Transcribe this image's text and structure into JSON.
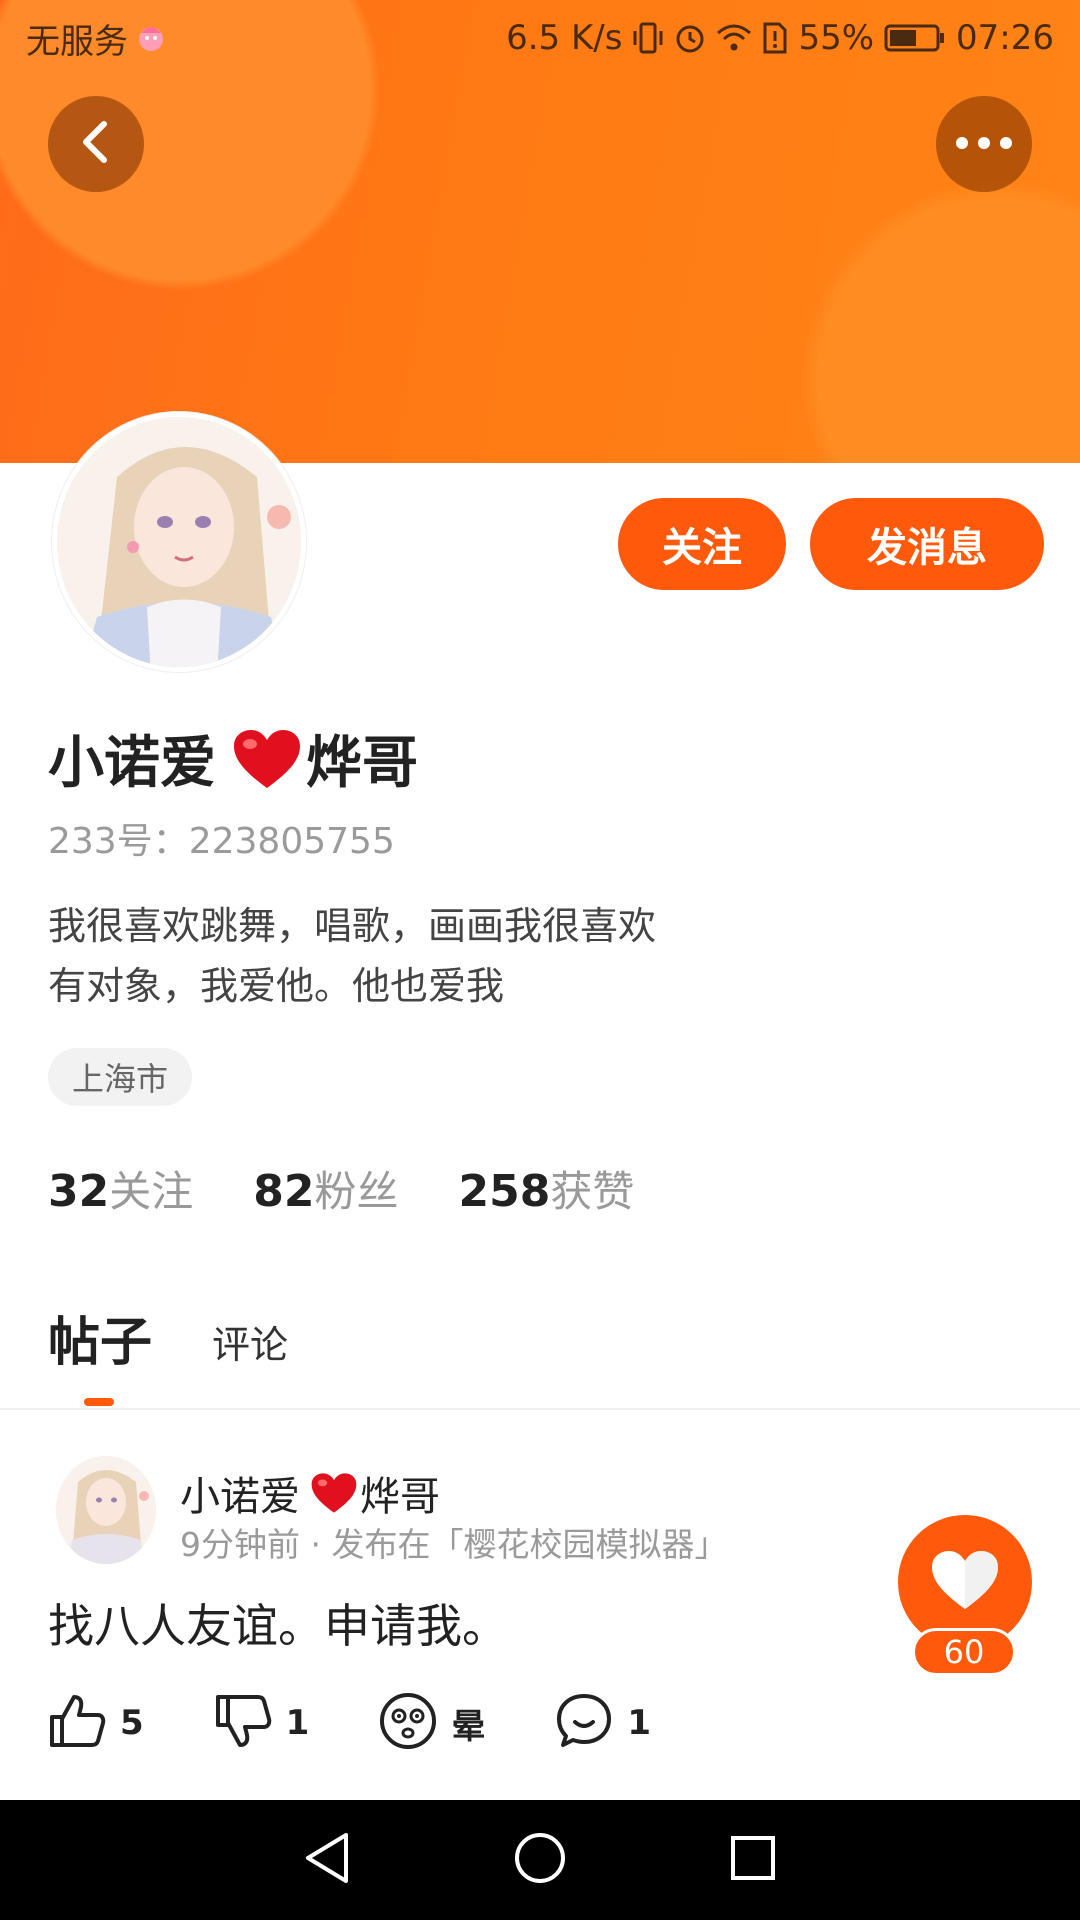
{
  "status_bar": {
    "carrier": "无服务",
    "speed": "6.5 K/s",
    "battery": "55%",
    "time": "07:26"
  },
  "header": {
    "back_icon": "chevron-left-icon",
    "more_icon": "ellipsis-icon"
  },
  "profile": {
    "name_part1": "小诺爱",
    "name_part2": "烨哥",
    "user_id": "233号：223805755",
    "bio_line1": "我很喜欢跳舞，唱歌，画画我很喜欢",
    "bio_line2": "有对象，我爱他。他也爱我",
    "location": "上海市",
    "follow_button": "关注",
    "message_button": "发消息",
    "stats": [
      {
        "num": "32",
        "label": "关注"
      },
      {
        "num": "82",
        "label": "粉丝"
      },
      {
        "num": "258",
        "label": "获赞"
      }
    ]
  },
  "tabs": [
    {
      "label": "帖子",
      "active": true
    },
    {
      "label": "评论",
      "active": false
    }
  ],
  "post": {
    "author_part1": "小诺爱",
    "author_part2": "烨哥",
    "meta": "9分钟前 · 发布在「樱花校园模拟器」",
    "text": "找八人友谊。申请我。",
    "likes": "5",
    "dislikes": "1",
    "dizzy_label": "晕",
    "comments": "1",
    "heart_count": "60"
  },
  "colors": {
    "accent": "#ff5a0c",
    "header_orange": "#ff7a14"
  }
}
